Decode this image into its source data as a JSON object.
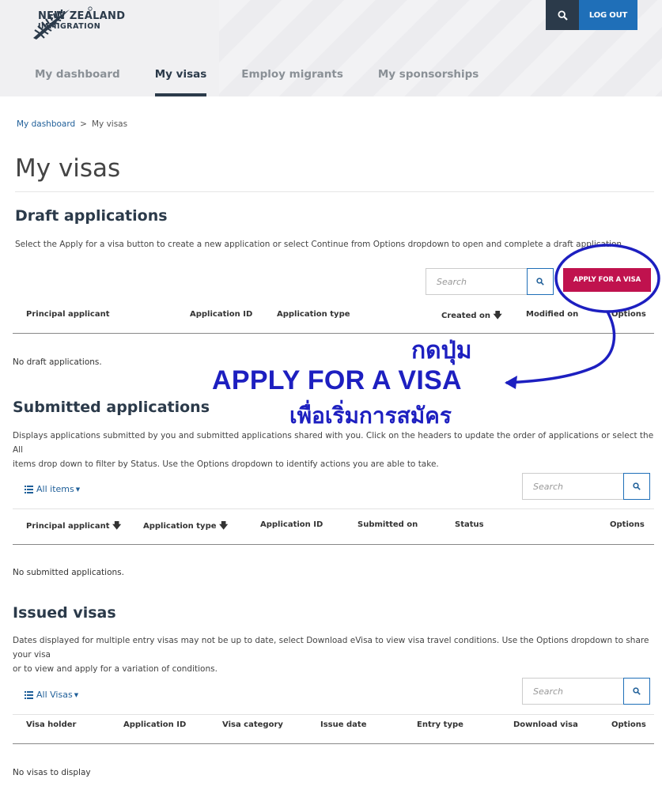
{
  "header": {
    "logo_line1": "NEW ZEALAND",
    "logo_line2": "IMMIGRATION",
    "logout_label": "LOG OUT",
    "search_icon": "search-icon"
  },
  "nav": {
    "items": [
      {
        "label": "My dashboard"
      },
      {
        "label": "My visas"
      },
      {
        "label": "Employ migrants"
      },
      {
        "label": "My sponsorships"
      }
    ],
    "active": "My visas"
  },
  "breadcrumb": {
    "link": "My dashboard",
    "separator": ">",
    "current": "My visas"
  },
  "page_title": "My visas",
  "draft": {
    "title": "Draft applications",
    "desc": "Select the Apply for a visa button to create a new application or select Continue from Options dropdown to open and complete a draft application.",
    "search_placeholder": "Search",
    "apply_label": "APPLY FOR A VISA",
    "columns": [
      "Principal applicant",
      "Application ID",
      "Application type",
      "Created on",
      "Modified on",
      "Options"
    ],
    "empty": "No draft applications."
  },
  "submitted": {
    "title": "Submitted applications",
    "desc_line1": "Displays applications submitted by you and submitted applications shared with you. Click on the headers to update the order of applications or select the All",
    "desc_line2": "items drop down to filter by Status. Use the Options dropdown to identify actions you are able to take.",
    "filter_label": "All items",
    "search_placeholder": "Search",
    "columns": [
      "Principal applicant",
      "Application type",
      "Application ID",
      "Submitted on",
      "Status",
      "Options"
    ],
    "empty": "No submitted applications."
  },
  "issued": {
    "title": "Issued visas",
    "desc_line1": "Dates displayed for multiple entry visas may not be up to date, select Download eVisa to view visa travel conditions. Use the Options dropdown to share your visa",
    "desc_line2": "or to view and apply for a variation of conditions.",
    "filter_label": "All Visas",
    "search_placeholder": "Search",
    "columns": [
      "Visa holder",
      "Application ID",
      "Visa category",
      "Issue date",
      "Entry type",
      "Download visa",
      "Options"
    ],
    "empty": "No visas to display"
  },
  "annotation": {
    "thai_line1": "กดปุ่ม",
    "main": "APPLY FOR A VISA",
    "thai_line2": "เพื่อเริ่มการสมัคร",
    "color": "#1d1fc0"
  },
  "colors": {
    "brand_dark": "#2b3a4a",
    "logout_blue": "#1f6fb8",
    "apply_red": "#c0124e",
    "link_blue": "#1f5f99"
  }
}
